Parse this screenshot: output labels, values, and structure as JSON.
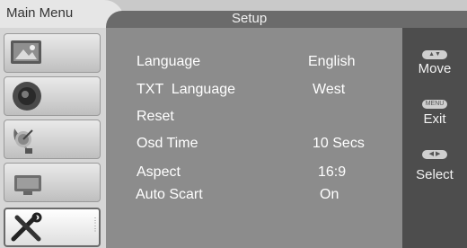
{
  "header": {
    "main_menu": "Main Menu",
    "title": "Setup"
  },
  "sidebar": {
    "items": [
      {
        "icon": "picture-icon"
      },
      {
        "icon": "speaker-icon"
      },
      {
        "icon": "satellite-dish-icon"
      },
      {
        "icon": "tv-icon"
      },
      {
        "icon": "tools-icon",
        "active": true
      }
    ]
  },
  "settings": [
    {
      "label": "Language",
      "value": "English"
    },
    {
      "label": "TXT  Language",
      "value": "West"
    },
    {
      "label": "Reset",
      "value": ""
    },
    {
      "label": "Osd Time",
      "value": "10 Secs"
    },
    {
      "label": "Aspect",
      "value": "16:9"
    },
    {
      "label": "Auto Scart",
      "value": "On"
    }
  ],
  "help": {
    "move": {
      "key": "▲▼",
      "label": "Move"
    },
    "exit": {
      "key": "MENU",
      "label": "Exit"
    },
    "select": {
      "key": "◀ ▶",
      "label": "Select"
    }
  }
}
